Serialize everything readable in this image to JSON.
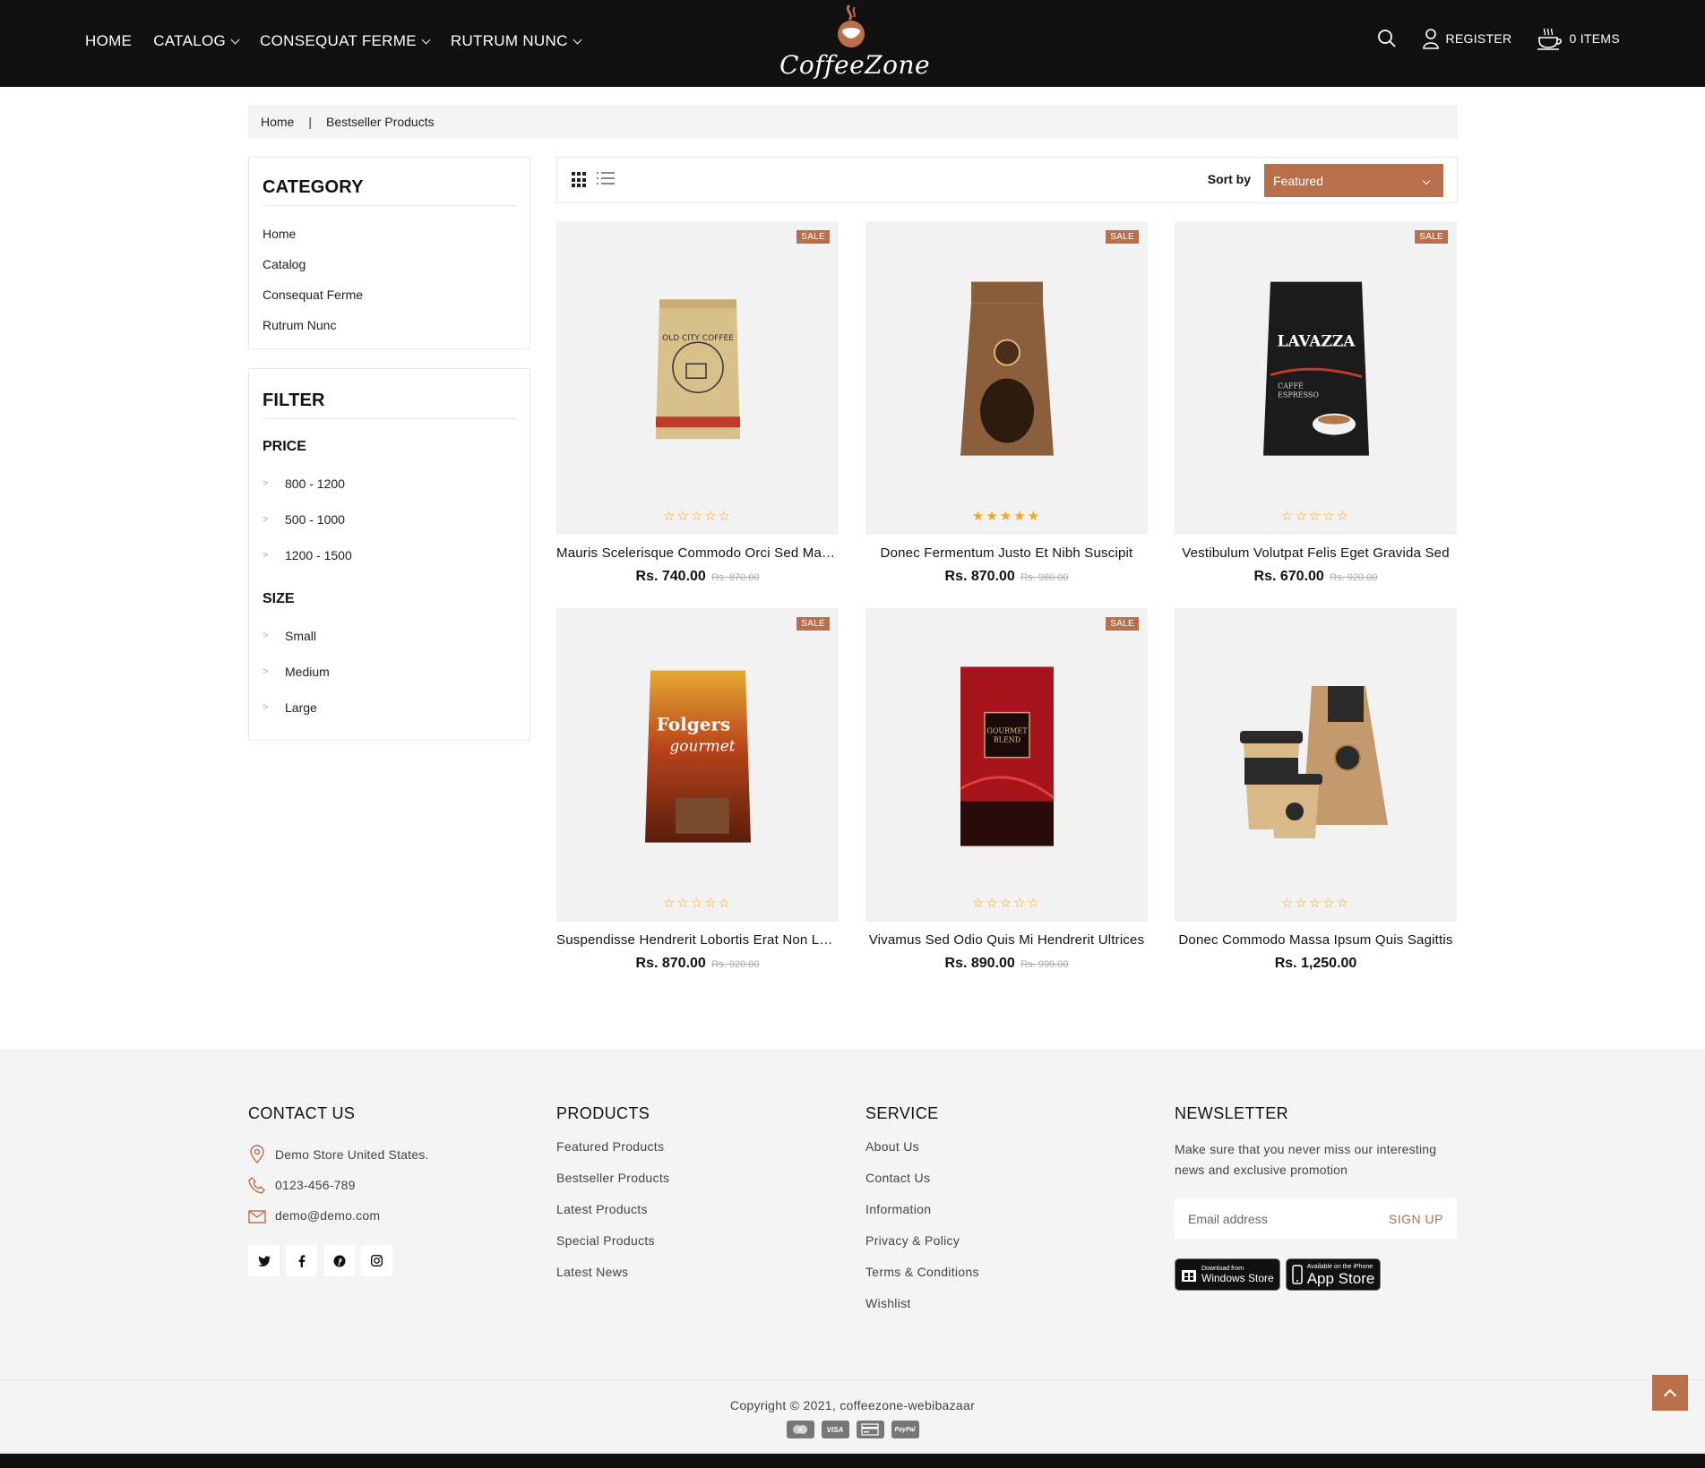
{
  "header": {
    "nav": [
      {
        "label": "HOME",
        "dropdown": false
      },
      {
        "label": "CATALOG",
        "dropdown": true
      },
      {
        "label": "CONSEQUAT FERME",
        "dropdown": true
      },
      {
        "label": "RUTRUM NUNC",
        "dropdown": true
      }
    ],
    "logo_text": "CoffeeZone",
    "register_label": "REGISTER",
    "cart_label": "0 ITEMS",
    "icons": {
      "search": "search-icon",
      "user": "user-icon",
      "cart": "coffee-cup-icon"
    }
  },
  "breadcrumb": {
    "home": "Home",
    "separator": "|",
    "current": "Bestseller Products"
  },
  "sidebar": {
    "category_title": "CATEGORY",
    "categories": [
      "Home",
      "Catalog",
      "Consequat Ferme",
      "Rutrum Nunc"
    ],
    "filter_title": "FILTER",
    "price_title": "PRICE",
    "prices": [
      "800 - 1200",
      "500 - 1000",
      "1200 - 1500"
    ],
    "size_title": "SIZE",
    "sizes": [
      "Small",
      "Medium",
      "Large"
    ],
    "arrow": ">"
  },
  "toolbar": {
    "sort_label": "Sort by",
    "sort_value": "Featured"
  },
  "products": [
    {
      "name": "Mauris Scelerisque Commodo Orci Sed Mattis",
      "price": "Rs. 740.00",
      "old_price": "Rs. 870.00",
      "sale": "SALE",
      "stars": "☆☆☆☆☆",
      "image": "old-city-coffee-bag"
    },
    {
      "name": "Donec Fermentum Justo Et Nibh Suscipit",
      "price": "Rs. 870.00",
      "old_price": "Rs. 980.00",
      "sale": "SALE",
      "stars": "★★★★★",
      "image": "brown-window-coffee-bag"
    },
    {
      "name": "Vestibulum Volutpat Felis Eget Gravida Sed",
      "price": "Rs. 670.00",
      "old_price": "Rs. 920.00",
      "sale": "SALE",
      "stars": "☆☆☆☆☆",
      "image": "lavazza-espresso-bag"
    },
    {
      "name": "Suspendisse Hendrerit Lobortis Erat Non Luctus",
      "price": "Rs. 870.00",
      "old_price": "Rs. 920.00",
      "sale": "SALE",
      "stars": "☆☆☆☆☆",
      "image": "folgers-gourmet-bag"
    },
    {
      "name": "Vivamus Sed Odio Quis Mi Hendrerit Ultrices",
      "price": "Rs. 890.00",
      "old_price": "Rs. 999.00",
      "sale": "SALE",
      "stars": "☆☆☆☆☆",
      "image": "gourmet-blend-box"
    },
    {
      "name": "Donec Commodo Massa Ipsum Quis Sagittis",
      "price": "Rs. 1,250.00",
      "old_price": "",
      "sale": "",
      "stars": "☆☆☆☆☆",
      "image": "coffee-cups-and-bag"
    }
  ],
  "footer": {
    "contact": {
      "title": "CONTACT US",
      "address": "Demo Store United States.",
      "phone": "0123-456-789",
      "email": "demo@demo.com",
      "social": [
        "twitter-icon",
        "facebook-icon",
        "pinterest-icon",
        "instagram-icon"
      ]
    },
    "products": {
      "title": "PRODUCTS",
      "links": [
        "Featured Products",
        "Bestseller Products",
        "Latest Products",
        "Special Products",
        "Latest News"
      ]
    },
    "service": {
      "title": "SERVICE",
      "links": [
        "About Us",
        "Contact Us",
        "Information",
        "Privacy & Policy",
        "Terms & Conditions",
        "Wishlist"
      ]
    },
    "newsletter": {
      "title": "NEWSLETTER",
      "text": "Make sure that you never miss our interesting news and exclusive promotion",
      "placeholder": "Email address",
      "button": "SIGN UP",
      "windows_small": "Download from",
      "windows_big": "Windows Store",
      "apple_small": "Available on the iPhone",
      "apple_big": "App Store"
    },
    "copyright": "Copyright © 2021, coffeezone-webibazaar",
    "payments": [
      "mastercard-icon",
      "visa-icon",
      "credit-card-icon",
      "paypal-icon"
    ],
    "payment_labels": {
      "visa": "VISA",
      "paypal": "PayPal"
    }
  },
  "colors": {
    "accent": "#b86f4a",
    "header_bg": "#111111",
    "footer_bg": "#f4f4f4",
    "star": "#f5a623"
  }
}
